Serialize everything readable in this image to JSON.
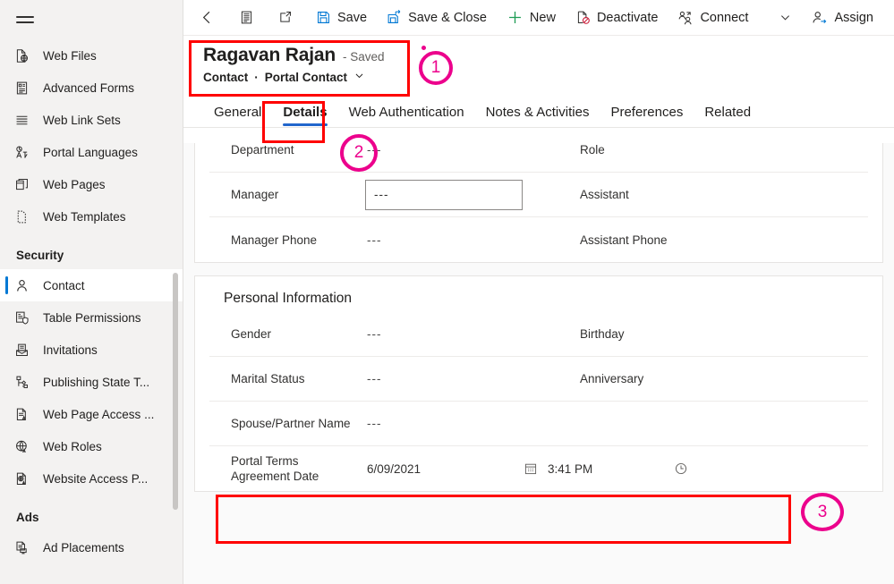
{
  "sidebar": {
    "menu_icon": "hamburger-icon",
    "items": [
      {
        "label": "Web Files",
        "icon": "web-file-icon",
        "selected": false
      },
      {
        "label": "Advanced Forms",
        "icon": "advanced-form-icon",
        "selected": false
      },
      {
        "label": "Web Link Sets",
        "icon": "web-link-set-icon",
        "selected": false
      },
      {
        "label": "Portal Languages",
        "icon": "portal-language-icon",
        "selected": false
      },
      {
        "label": "Web Pages",
        "icon": "web-page-icon",
        "selected": false
      },
      {
        "label": "Web Templates",
        "icon": "web-template-icon",
        "selected": false
      }
    ],
    "groups": [
      {
        "title": "Security",
        "items": [
          {
            "label": "Contact",
            "icon": "contact-person-icon",
            "selected": true
          },
          {
            "label": "Table Permissions",
            "icon": "table-permission-icon",
            "selected": false
          },
          {
            "label": "Invitations",
            "icon": "invitation-icon",
            "selected": false
          },
          {
            "label": "Publishing State T...",
            "icon": "publishing-state-icon",
            "selected": false
          },
          {
            "label": "Web Page Access ...",
            "icon": "web-page-access-icon",
            "selected": false
          },
          {
            "label": "Web Roles",
            "icon": "web-role-icon",
            "selected": false
          },
          {
            "label": "Website Access P...",
            "icon": "website-access-icon",
            "selected": false
          }
        ]
      },
      {
        "title": "Ads",
        "items": [
          {
            "label": "Ad Placements",
            "icon": "ad-placement-icon",
            "selected": false
          }
        ]
      }
    ]
  },
  "commandbar": {
    "items": [
      {
        "label": "",
        "icon": "back-arrow-icon",
        "name": "back-button"
      },
      {
        "label": "",
        "icon": "form-icon",
        "name": "show-chart-button"
      },
      {
        "label": "",
        "icon": "popout-icon",
        "name": "open-in-new-window-button"
      },
      {
        "label": "Save",
        "icon": "save-icon",
        "name": "save-button"
      },
      {
        "label": "Save & Close",
        "icon": "save-close-icon",
        "name": "save-and-close-button"
      },
      {
        "label": "New",
        "icon": "plus-icon",
        "name": "new-button"
      },
      {
        "label": "Deactivate",
        "icon": "deactivate-icon",
        "name": "deactivate-button"
      },
      {
        "label": "Connect",
        "icon": "connect-icon",
        "name": "connect-button"
      },
      {
        "label": "",
        "icon": "chevron-down-icon",
        "name": "connect-dropdown-button"
      },
      {
        "label": "Assign",
        "icon": "assign-icon",
        "name": "assign-button"
      },
      {
        "label": "",
        "icon": "email-link-icon",
        "name": "email-a-link-button"
      }
    ]
  },
  "record": {
    "title": "Ragavan Rajan",
    "saved_status": "- Saved",
    "entity": "Contact",
    "separator": "·",
    "form_name": "Portal Contact",
    "form_chevron": "chevron-down-icon"
  },
  "tabs": [
    {
      "label": "General",
      "active": false
    },
    {
      "label": "Details",
      "active": true
    },
    {
      "label": "Web Authentication",
      "active": false
    },
    {
      "label": "Notes & Activities",
      "active": false
    },
    {
      "label": "Preferences",
      "active": false
    },
    {
      "label": "Related",
      "active": false
    }
  ],
  "sections": [
    {
      "name": "manager-section",
      "title": "",
      "clipped": true,
      "rows": [
        {
          "left": {
            "label": "Department",
            "value": "---",
            "kind": "text"
          },
          "right": {
            "label": "Role",
            "value": "",
            "kind": "text"
          }
        },
        {
          "left": {
            "label": "Manager",
            "value": "---",
            "kind": "input"
          },
          "right": {
            "label": "Assistant",
            "value": "",
            "kind": "text"
          }
        },
        {
          "left": {
            "label": "Manager Phone",
            "value": "---",
            "kind": "text"
          },
          "right": {
            "label": "Assistant Phone",
            "value": "",
            "kind": "text"
          }
        }
      ]
    },
    {
      "name": "personal-information-section",
      "title": "Personal Information",
      "clipped": false,
      "rows": [
        {
          "left": {
            "label": "Gender",
            "value": "---",
            "kind": "text"
          },
          "right": {
            "label": "Birthday",
            "value": "",
            "kind": "text"
          }
        },
        {
          "left": {
            "label": "Marital Status",
            "value": "---",
            "kind": "text"
          },
          "right": {
            "label": "Anniversary",
            "value": "",
            "kind": "text"
          }
        },
        {
          "left": {
            "label": "Spouse/Partner Name",
            "value": "---",
            "kind": "text"
          },
          "right": {
            "label": "",
            "value": "",
            "kind": "text"
          }
        },
        {
          "left": {
            "label": "Portal Terms Agreement Date",
            "value": "6/09/2021",
            "time": "3:41 PM",
            "kind": "datetime",
            "date_icon": "calendar-icon",
            "time_icon": "clock-icon"
          },
          "right": {
            "label": "",
            "value": "",
            "kind": "text"
          }
        }
      ]
    }
  ],
  "annotations": {
    "accent_color": "#ec008c",
    "box_color": "#ff0000",
    "callouts": [
      {
        "number": "1",
        "target": "record-header-box"
      },
      {
        "number": "2",
        "target": "details-tab-box"
      },
      {
        "number": "3",
        "target": "portal-terms-agreement-date-box"
      }
    ]
  }
}
